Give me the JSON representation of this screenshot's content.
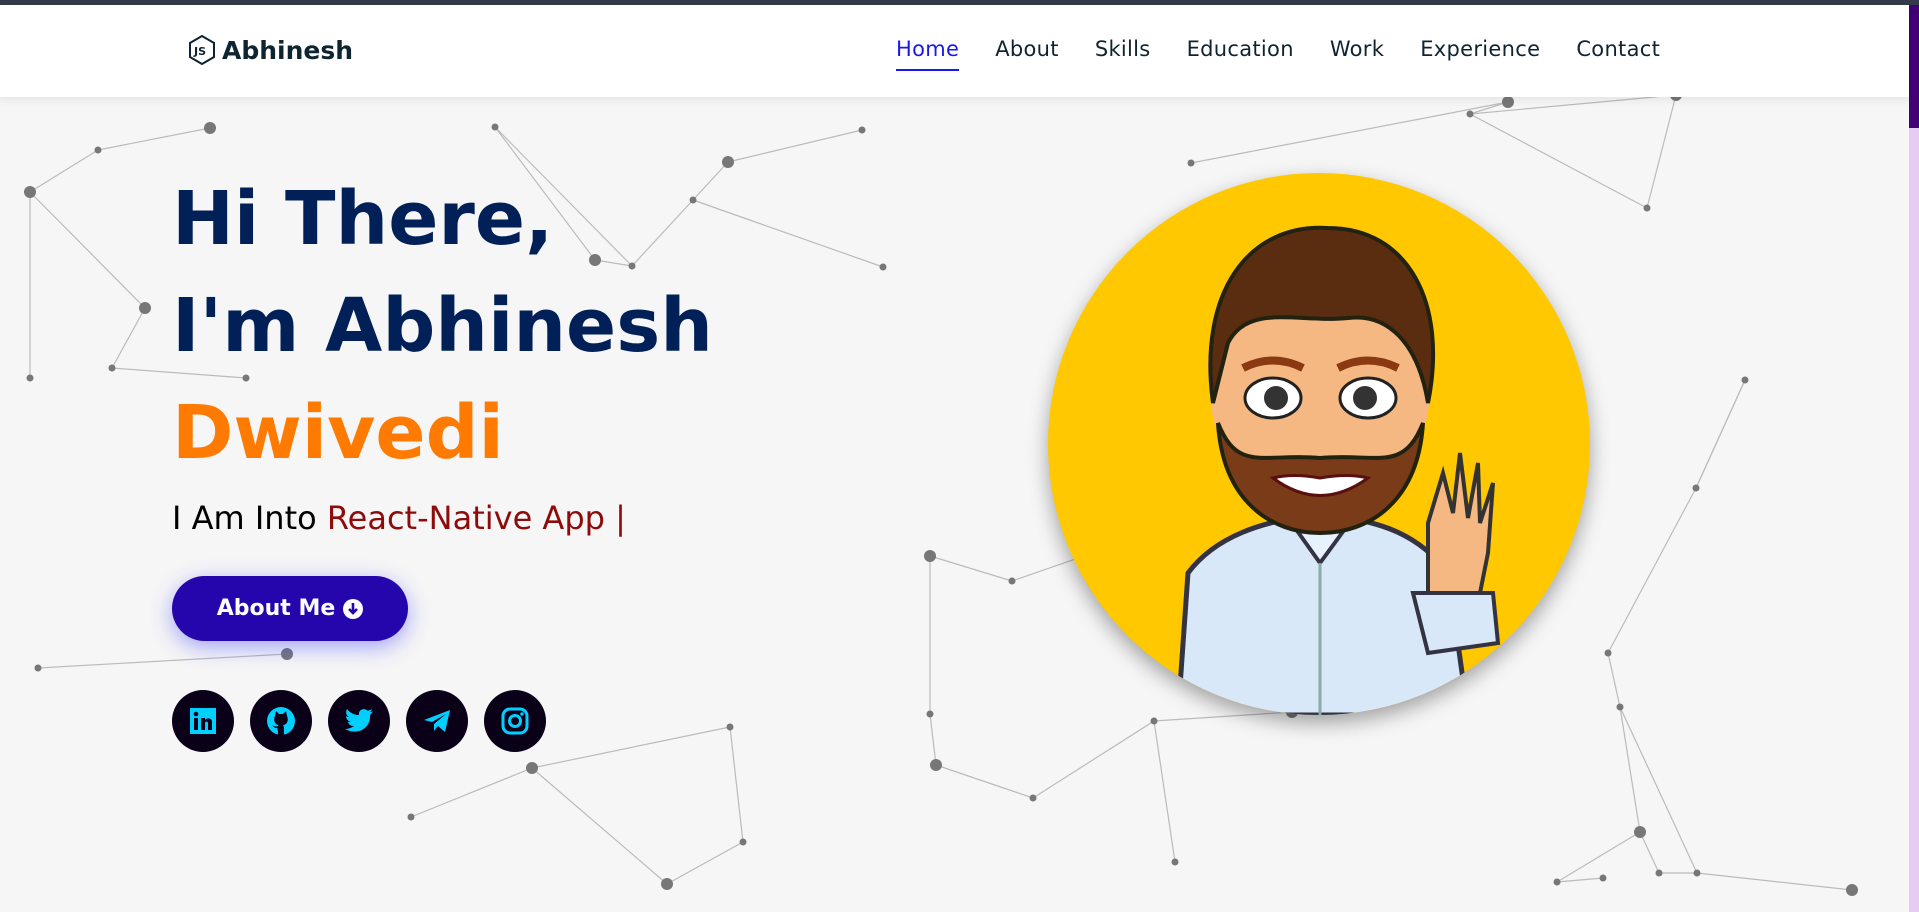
{
  "brand": {
    "name": "Abhinesh",
    "logo_icon": "nodejs-hexagon-js-icon"
  },
  "nav": {
    "items": [
      {
        "label": "Home",
        "active": true
      },
      {
        "label": "About"
      },
      {
        "label": "Skills"
      },
      {
        "label": "Education"
      },
      {
        "label": "Work"
      },
      {
        "label": "Experience"
      },
      {
        "label": "Contact"
      }
    ]
  },
  "hero": {
    "line1": "Hi There,",
    "line2": "I'm Abhinesh",
    "line3": "Dwivedi",
    "sub_prefix": "I Am Into",
    "sub_typed": "React-Native App |",
    "button": "About Me",
    "button_icon": "arrow-circle-down-icon"
  },
  "socials": [
    "linkedin-icon",
    "github-icon",
    "twitter-icon",
    "telegram-icon",
    "instagram-icon"
  ],
  "colors": {
    "accent": "#2506ad",
    "name_orange": "#ff7a00",
    "heading": "#002057",
    "typed": "#8d0b0b",
    "social_icon": "#00d0ff",
    "avatar_bg": "#ffc800"
  }
}
